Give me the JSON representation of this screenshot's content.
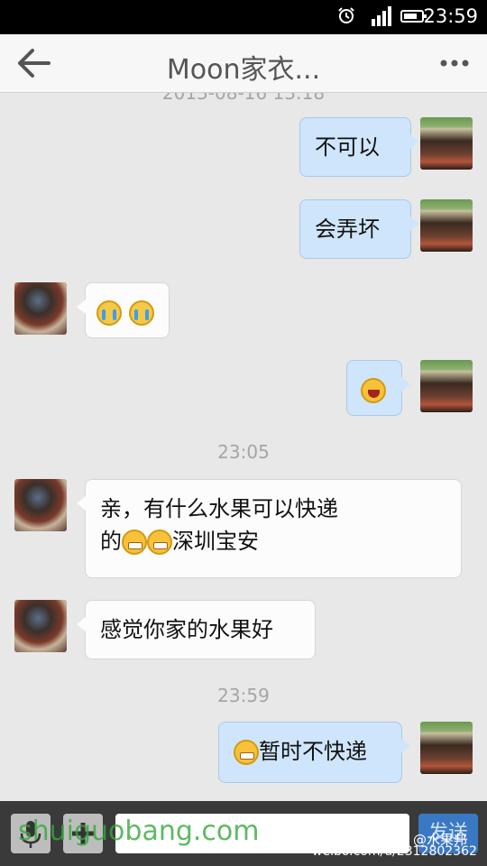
{
  "status_bar": {
    "time": "23:59"
  },
  "header": {
    "title": "Moon家衣...",
    "back_icon": "back-arrow-icon",
    "more_icon": "more-dots-icon"
  },
  "chat": {
    "timestamp_partial": "2013-08-16 13:18",
    "timestamps": [
      "23:05",
      "23:59"
    ],
    "messages": [
      {
        "from": "me",
        "text": "不可以"
      },
      {
        "from": "me",
        "text": "会弄坏"
      },
      {
        "from": "other",
        "emoji": [
          "crying-face",
          "crying-face"
        ]
      },
      {
        "from": "me",
        "emoji": [
          "laughing-face"
        ]
      },
      {
        "from": "other",
        "text_line1": "亲，有什么水果可以快递",
        "text_line2_prefix": "的",
        "text_line2_suffix": "深圳宝安",
        "emoji": [
          "grin-face",
          "grin-face"
        ]
      },
      {
        "from": "other",
        "text": "感觉你家的水果好"
      },
      {
        "from": "me",
        "text": "暂时不快递",
        "emoji": [
          "grin-face"
        ]
      }
    ]
  },
  "input_bar": {
    "send_label": "发送",
    "mic_icon": "mic-icon",
    "plus_icon": "plus-icon",
    "field_placeholder": ""
  },
  "watermarks": {
    "site": "shuiguobang.com",
    "site_cn": "水果邦",
    "weibo": "weibo.com/u/2312802362",
    "weibo_name": "@水果邦"
  }
}
